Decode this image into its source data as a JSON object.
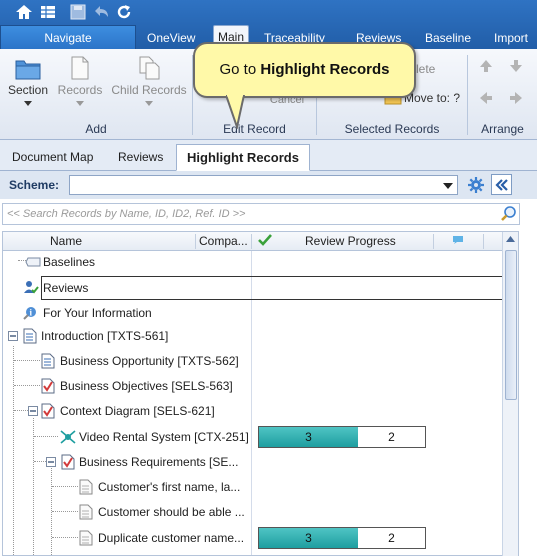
{
  "ribbon_tabs": {
    "navigate": "Navigate",
    "oneview": "OneView",
    "main": "Main",
    "traceability": "Traceability",
    "reviews": "Reviews",
    "baseline": "Baseline",
    "import": "Import"
  },
  "ribbon": {
    "section": "Section",
    "records": "Records",
    "child_records": "Child Records",
    "delete_label": "lete",
    "cancel_label": "Cancel",
    "move_to": "Move to: ?",
    "groups": {
      "add": "Add",
      "edit_record": "Edit Record",
      "selected_records": "Selected Records",
      "arrange": "Arrange"
    }
  },
  "callout": {
    "prefix": "Go to ",
    "bold": "Highlight Records"
  },
  "panel_tabs": {
    "document_map": "Document Map",
    "reviews": "Reviews",
    "highlight_records": "Highlight Records"
  },
  "scheme": {
    "label": "Scheme:",
    "value": ""
  },
  "search": {
    "placeholder": "<< Search Records by Name, ID, ID2, Ref. ID >>"
  },
  "grid": {
    "columns": {
      "name": "Name",
      "compa": "Compa...",
      "review_progress": "Review Progress"
    },
    "rows": [
      {
        "label": "Baselines"
      },
      {
        "label": "Reviews"
      },
      {
        "label": "For Your Information"
      },
      {
        "label": "Introduction [TXTS-561]"
      },
      {
        "label": "Business Opportunity [TXTS-562]"
      },
      {
        "label": "Business Objectives [SELS-563]"
      },
      {
        "label": "Context Diagram [SELS-621]"
      },
      {
        "label": "Video Rental System [CTX-251]",
        "progress": [
          "3",
          "2"
        ]
      },
      {
        "label": "Business Requirements [SE..."
      },
      {
        "label": "Customer's first name, la..."
      },
      {
        "label": "Customer should be able ..."
      },
      {
        "label": "Duplicate customer name...",
        "progress": [
          "3",
          "2"
        ]
      }
    ]
  },
  "colors": {
    "ribbon_blue": "#2f73c3",
    "progress_teal": "#1e9ea0",
    "callout_yellow": "#fff9a8"
  }
}
